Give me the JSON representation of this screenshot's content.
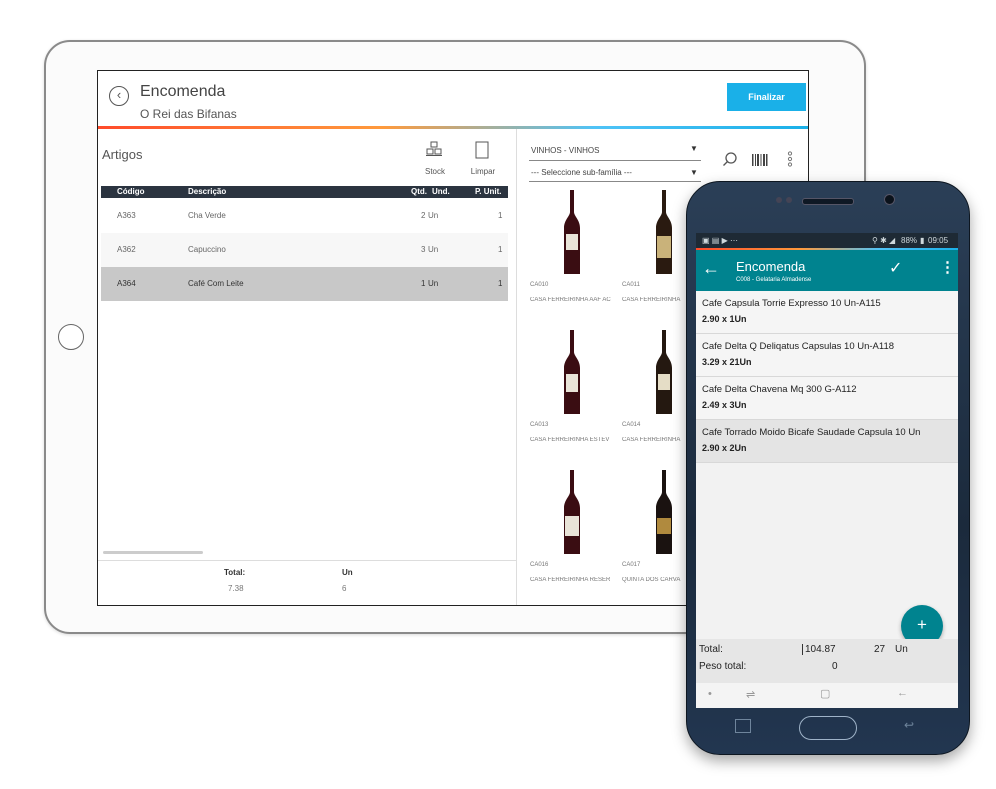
{
  "tablet": {
    "title": "Encomenda",
    "subtitle": "O Rei das Bifanas",
    "finalize_label": "Finalizar",
    "back_icon": "back-circle-icon",
    "section_title": "Artigos",
    "tools": [
      {
        "label": "Stock",
        "icon": "stock-boxes-icon"
      },
      {
        "label": "Limpar",
        "icon": "clear-icon"
      }
    ],
    "table": {
      "headers": [
        "Código",
        "Descrição",
        "Qtd.",
        "Und.",
        "P. Unit."
      ],
      "rows": [
        {
          "code": "A363",
          "desc": "Cha Verde",
          "qty": "2",
          "unit": "Un",
          "price": "1"
        },
        {
          "code": "A362",
          "desc": "Capuccino",
          "qty": "3",
          "unit": "Un",
          "price": "1"
        },
        {
          "code": "A364",
          "desc": "Café Com Leite",
          "qty": "1",
          "unit": "Un",
          "price": "1"
        }
      ]
    },
    "totals": {
      "total_label": "Total:",
      "total_value": "7.38",
      "un_label": "Un",
      "un_value": "6"
    },
    "catalog": {
      "family": "VINHOS - VINHOS",
      "subfamily_placeholder": "--- Seleccione sub-família ---",
      "products": [
        {
          "code": "CA010",
          "name": "CASA FERREIRINHA AAF AC"
        },
        {
          "code": "CA011",
          "name": "CASA FERREIRINHA"
        },
        {
          "code": "CA013",
          "name": "CASA FERREIRINHA ESTEV"
        },
        {
          "code": "CA014",
          "name": "CASA FERREIRINHA"
        },
        {
          "code": "CA016",
          "name": "CASA FERREIRINHA RESER"
        },
        {
          "code": "CA017",
          "name": "QUINTA DOS CARVA"
        }
      ]
    }
  },
  "phone": {
    "status": {
      "icons_left": "▣ ▤ ▶ ⋯",
      "battery": "88%",
      "time": "09:05"
    },
    "title": "Encomenda",
    "subtitle": "C008 - Gelataria Almadense",
    "items": [
      {
        "name": "Cafe Capsula Torrie Expresso 10 Un-A115",
        "qty": "2.90  x 1Un"
      },
      {
        "name": "Cafe Delta Q Deliqatus Capsulas 10 Un-A118",
        "qty": "3.29  x 21Un"
      },
      {
        "name": "Cafe Delta Chavena Mq 300 G-A112",
        "qty": "2.49  x 3Un"
      },
      {
        "name": "Cafe Torrado Moido Bicafe Saudade Capsula 10 Un",
        "qty": "2.90  x 2Un"
      }
    ],
    "fab_label": "+",
    "totals": {
      "total_label": "Total:",
      "total_value": "104.87",
      "units_value": "27",
      "units_label": "Un",
      "weight_label": "Peso total:",
      "weight_value": "0"
    },
    "nav": {
      "dot": "•",
      "recent": "⇌",
      "home": "▢",
      "back": "←"
    }
  }
}
